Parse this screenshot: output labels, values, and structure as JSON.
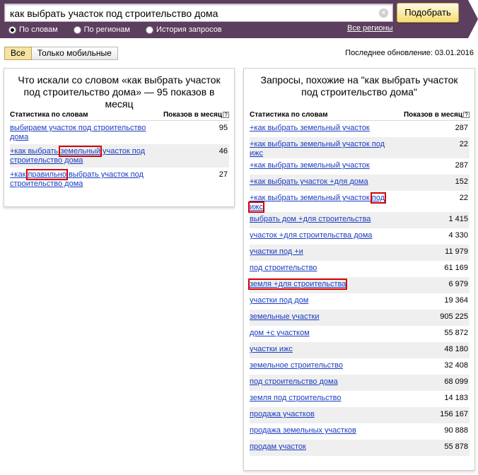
{
  "search": {
    "value": "как выбрать участок под строительство дома",
    "button_label": "Подобрать",
    "clear_icon": "×",
    "modes": [
      {
        "label": "По словам",
        "checked": true
      },
      {
        "label": "По регионам",
        "checked": false
      },
      {
        "label": "История запросов",
        "checked": false
      }
    ],
    "regions_link": "Все регионы"
  },
  "filters": {
    "tabs": [
      {
        "label": "Все",
        "active": true
      },
      {
        "label": "Только мобильные",
        "active": false
      }
    ],
    "last_update": "Последнее обновление: 03.01.2016"
  },
  "left_panel": {
    "title": "Что искали со словом «как выбрать участок под строительство дома» — 95 показов в месяц",
    "col_phrase": "Статистика по словам",
    "col_count": "Показов в месяц",
    "help_icon": "?",
    "rows": [
      {
        "pre": "выбираем участок под строительство дома",
        "hl": "",
        "post": "",
        "count": "95"
      },
      {
        "pre": "+как выбрать ",
        "hl": "земельный",
        "post": " участок под строительство дома",
        "count": "46"
      },
      {
        "pre": "+как ",
        "hl": "правильно",
        "post": " выбрать участок под строительство дома",
        "count": "27"
      }
    ]
  },
  "right_panel": {
    "title": "Запросы, похожие на \"как выбрать участок под строительство дома\"",
    "col_phrase": "Статистика по словам",
    "col_count": "Показов в месяц",
    "help_icon": "?",
    "rows": [
      {
        "pre": "+как выбрать земельный участок",
        "hl": "",
        "post": "",
        "count": "287"
      },
      {
        "pre": "+как выбрать земельный участок под ижс",
        "hl": "",
        "post": "",
        "count": "22"
      },
      {
        "pre": "+как выбрать земельный участок",
        "hl": "",
        "post": "",
        "count": "287"
      },
      {
        "pre": "+как выбрать участок +для дома",
        "hl": "",
        "post": "",
        "count": "152"
      },
      {
        "pre": "+как выбрать земельный участок ",
        "hl": "под ижс",
        "post": "",
        "count": "22"
      },
      {
        "pre": "выбрать дом +для строительства",
        "hl": "",
        "post": "",
        "count": "1 415"
      },
      {
        "pre": "участок +для строительства дома",
        "hl": "",
        "post": "",
        "count": "4 330"
      },
      {
        "pre": "участки под +и",
        "hl": "",
        "post": "",
        "count": "11 979"
      },
      {
        "pre": "под строительство",
        "hl": "",
        "post": "",
        "count": "61 169"
      },
      {
        "pre": "",
        "hl": "земля +для строительства",
        "post": "",
        "count": "6 979"
      },
      {
        "pre": "участки под дом",
        "hl": "",
        "post": "",
        "count": "19 364"
      },
      {
        "pre": "земельные участки",
        "hl": "",
        "post": "",
        "count": "905 225"
      },
      {
        "pre": "дом +с участком",
        "hl": "",
        "post": "",
        "count": "55 872"
      },
      {
        "pre": "участки ижс",
        "hl": "",
        "post": "",
        "count": "48 180"
      },
      {
        "pre": "земельное строительство",
        "hl": "",
        "post": "",
        "count": "32 408"
      },
      {
        "pre": "под строительство дома",
        "hl": "",
        "post": "",
        "count": "68 099"
      },
      {
        "pre": "земля под строительство",
        "hl": "",
        "post": "",
        "count": "14 183"
      },
      {
        "pre": "продажа участков",
        "hl": "",
        "post": "",
        "count": "156 167"
      },
      {
        "pre": "продажа земельных участков",
        "hl": "",
        "post": "",
        "count": "90 888"
      },
      {
        "pre": "продам участок",
        "hl": "",
        "post": "",
        "count": "55 878"
      }
    ]
  },
  "colors": {
    "topbar": "#5c3e5e",
    "link": "#1a3dc1",
    "highlight": "#d40000",
    "button": "#f5dc70",
    "active_tab": "#f4e3a2"
  }
}
